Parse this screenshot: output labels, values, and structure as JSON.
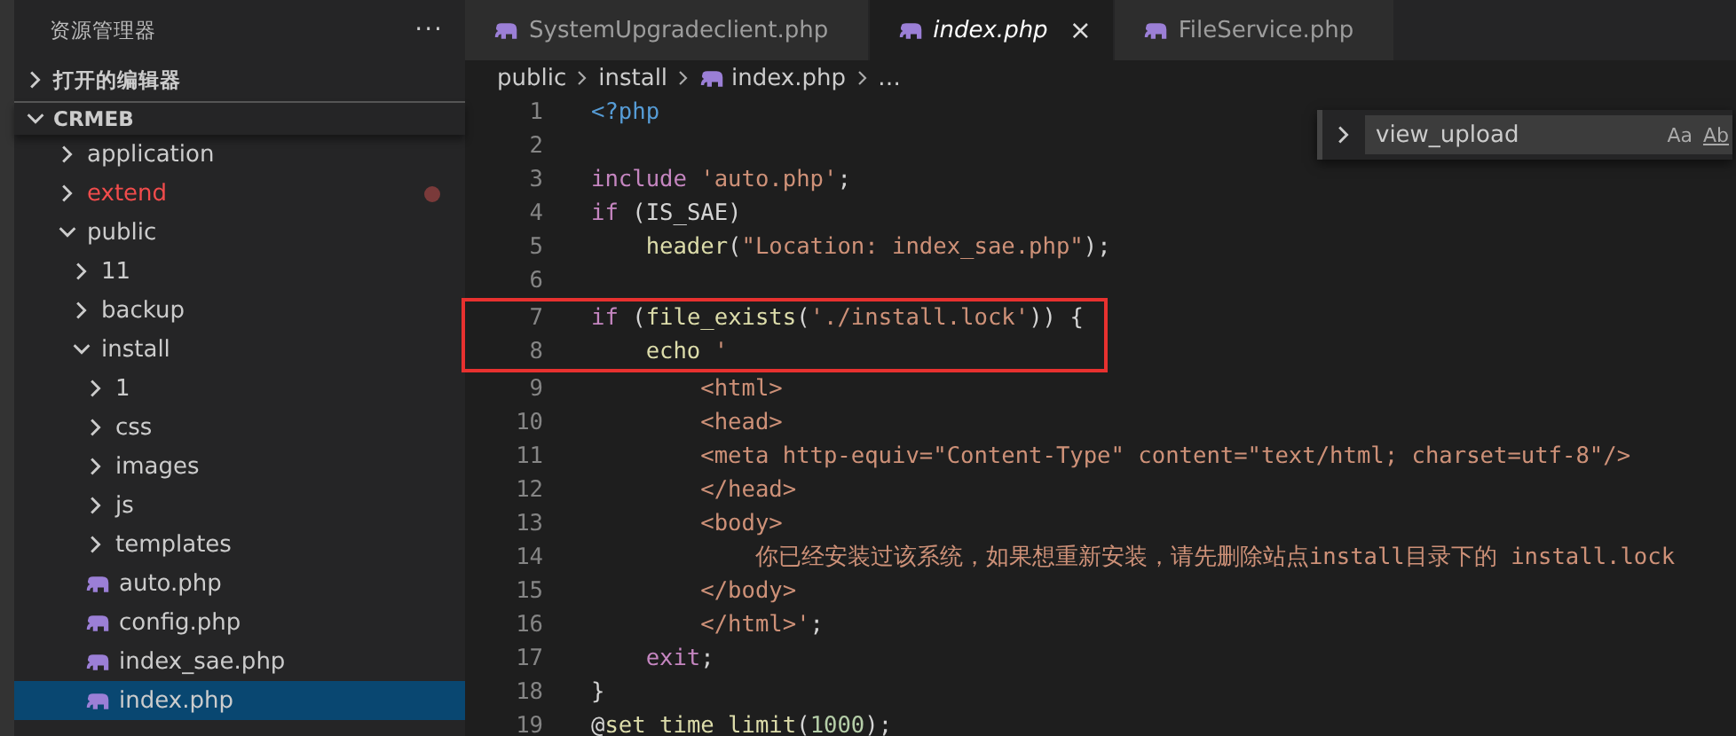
{
  "sidebar": {
    "title": "资源管理器",
    "more": "···",
    "sections": [
      {
        "label": "打开的编辑器",
        "expanded": false
      },
      {
        "label": "CRMEB",
        "expanded": true
      }
    ],
    "tree": [
      {
        "label": "application",
        "kind": "folder",
        "expanded": false,
        "selected": false,
        "modified": false
      },
      {
        "label": "extend",
        "kind": "folder",
        "expanded": false,
        "selected": false,
        "modified": true
      },
      {
        "label": "public",
        "kind": "folder",
        "expanded": true,
        "selected": false,
        "modified": false,
        "children": [
          {
            "label": "11",
            "kind": "folder",
            "expanded": false,
            "selected": false,
            "modified": false
          },
          {
            "label": "backup",
            "kind": "folder",
            "expanded": false,
            "selected": false,
            "modified": false
          },
          {
            "label": "install",
            "kind": "folder",
            "expanded": true,
            "selected": false,
            "modified": false,
            "children": [
              {
                "label": "1",
                "kind": "folder",
                "expanded": false,
                "selected": false,
                "modified": false
              },
              {
                "label": "css",
                "kind": "folder",
                "expanded": false,
                "selected": false,
                "modified": false
              },
              {
                "label": "images",
                "kind": "folder",
                "expanded": false,
                "selected": false,
                "modified": false
              },
              {
                "label": "js",
                "kind": "folder",
                "expanded": false,
                "selected": false,
                "modified": false
              },
              {
                "label": "templates",
                "kind": "folder",
                "expanded": false,
                "selected": false,
                "modified": false
              },
              {
                "label": "auto.php",
                "kind": "php",
                "selected": false,
                "modified": false
              },
              {
                "label": "config.php",
                "kind": "php",
                "selected": false,
                "modified": false
              },
              {
                "label": "index_sae.php",
                "kind": "php",
                "selected": false,
                "modified": false
              },
              {
                "label": "index.php",
                "kind": "php",
                "selected": true,
                "modified": false
              }
            ]
          }
        ]
      }
    ]
  },
  "tabs": [
    {
      "label": "SystemUpgradeclient.php",
      "selected": false
    },
    {
      "label": "index.php",
      "selected": true,
      "close": "×"
    },
    {
      "label": "FileService.php",
      "selected": false
    }
  ],
  "breadcrumb": [
    {
      "label": "public",
      "kind": "folder"
    },
    {
      "label": "install",
      "kind": "folder"
    },
    {
      "label": "index.php",
      "kind": "php"
    },
    {
      "label": "…",
      "kind": "more"
    }
  ],
  "find": {
    "value": "view_upload",
    "options": [
      "Aa",
      "Ab"
    ]
  },
  "code": [
    {
      "number": "1",
      "highlighted": false,
      "tokens": [
        {
          "kind": "tag",
          "text": "<?php"
        }
      ]
    },
    {
      "number": "2",
      "highlighted": false
    },
    {
      "number": "3",
      "highlighted": false,
      "tokens": [
        {
          "kind": "kw",
          "text": "include"
        },
        {
          "kind": "str",
          "text": " 'auto.php'"
        },
        {
          "kind": "plain",
          "text": ";"
        }
      ]
    },
    {
      "number": "4",
      "highlighted": false,
      "tokens": [
        {
          "kind": "kw",
          "text": "if"
        },
        {
          "kind": "plain",
          "text": " (IS_SAE)"
        }
      ]
    },
    {
      "number": "5",
      "highlighted": false,
      "tokens": [
        {
          "kind": "fn",
          "text": "    header"
        },
        {
          "kind": "plain",
          "text": "("
        },
        {
          "kind": "str",
          "text": "\"Location: index_sae.php\""
        },
        {
          "kind": "plain",
          "text": ");"
        }
      ]
    },
    {
      "number": "6",
      "highlighted": false
    },
    {
      "number": "7",
      "highlighted": true,
      "tokens": [
        {
          "kind": "kw",
          "text": "if"
        },
        {
          "kind": "plain",
          "text": " ("
        },
        {
          "kind": "fn",
          "text": "file_exists"
        },
        {
          "kind": "plain",
          "text": "("
        },
        {
          "kind": "str",
          "text": "'./install.lock'"
        },
        {
          "kind": "plain",
          "text": ")) {"
        }
      ]
    },
    {
      "number": "8",
      "highlighted": true,
      "tokens": [
        {
          "kind": "fn",
          "text": "    echo"
        },
        {
          "kind": "str",
          "text": " '"
        }
      ]
    },
    {
      "number": "9",
      "highlighted": false,
      "tokens": [
        {
          "kind": "str",
          "text": "        <html>"
        }
      ]
    },
    {
      "number": "10",
      "highlighted": false,
      "tokens": [
        {
          "kind": "str",
          "text": "        <head>"
        }
      ]
    },
    {
      "number": "11",
      "highlighted": false,
      "tokens": [
        {
          "kind": "str",
          "text": "        <meta http-equiv=\"Content-Type\" content=\"text/html; charset=utf-8\"/>"
        }
      ]
    },
    {
      "number": "12",
      "highlighted": false,
      "tokens": [
        {
          "kind": "str",
          "text": "        </head>"
        }
      ]
    },
    {
      "number": "13",
      "highlighted": false,
      "tokens": [
        {
          "kind": "str",
          "text": "        <body>"
        }
      ]
    },
    {
      "number": "14",
      "highlighted": false,
      "tokens": [
        {
          "kind": "str",
          "text": "            你已经安装过该系统，如果想重新安装，请先删除站点install目录下的 install.lock"
        }
      ]
    },
    {
      "number": "15",
      "highlighted": false,
      "tokens": [
        {
          "kind": "str",
          "text": "        </body>"
        }
      ]
    },
    {
      "number": "16",
      "highlighted": false,
      "tokens": [
        {
          "kind": "str",
          "text": "        </html>'"
        },
        {
          "kind": "plain",
          "text": ";"
        }
      ]
    },
    {
      "number": "17",
      "highlighted": false,
      "tokens": [
        {
          "kind": "kw",
          "text": "    exit"
        },
        {
          "kind": "plain",
          "text": ";"
        }
      ]
    },
    {
      "number": "18",
      "highlighted": false,
      "tokens": [
        {
          "kind": "plain",
          "text": "}"
        }
      ]
    },
    {
      "number": "19",
      "highlighted": false,
      "tokens": [
        {
          "kind": "plain",
          "text": "@"
        },
        {
          "kind": "fn",
          "text": "set_time_limit"
        },
        {
          "kind": "plain",
          "text": "("
        },
        {
          "kind": "num",
          "text": "1000"
        },
        {
          "kind": "plain",
          "text": ");"
        }
      ]
    }
  ]
}
